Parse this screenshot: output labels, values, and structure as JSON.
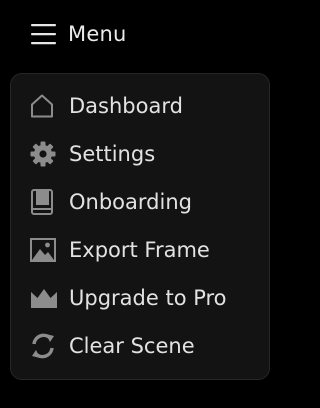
{
  "header": {
    "title": "Menu",
    "icon": "hamburger-icon"
  },
  "menu": {
    "items": [
      {
        "label": "Dashboard",
        "icon": "home-icon"
      },
      {
        "label": "Settings",
        "icon": "gear-icon"
      },
      {
        "label": "Onboarding",
        "icon": "book-icon"
      },
      {
        "label": "Export Frame",
        "icon": "image-icon"
      },
      {
        "label": "Upgrade to Pro",
        "icon": "crown-icon"
      },
      {
        "label": "Clear Scene",
        "icon": "refresh-icon"
      }
    ]
  },
  "colors": {
    "background": "#000000",
    "panel": "#131313",
    "panel_border": "#262626",
    "text": "#e2e2e2",
    "icon": "#8c8c8c"
  }
}
